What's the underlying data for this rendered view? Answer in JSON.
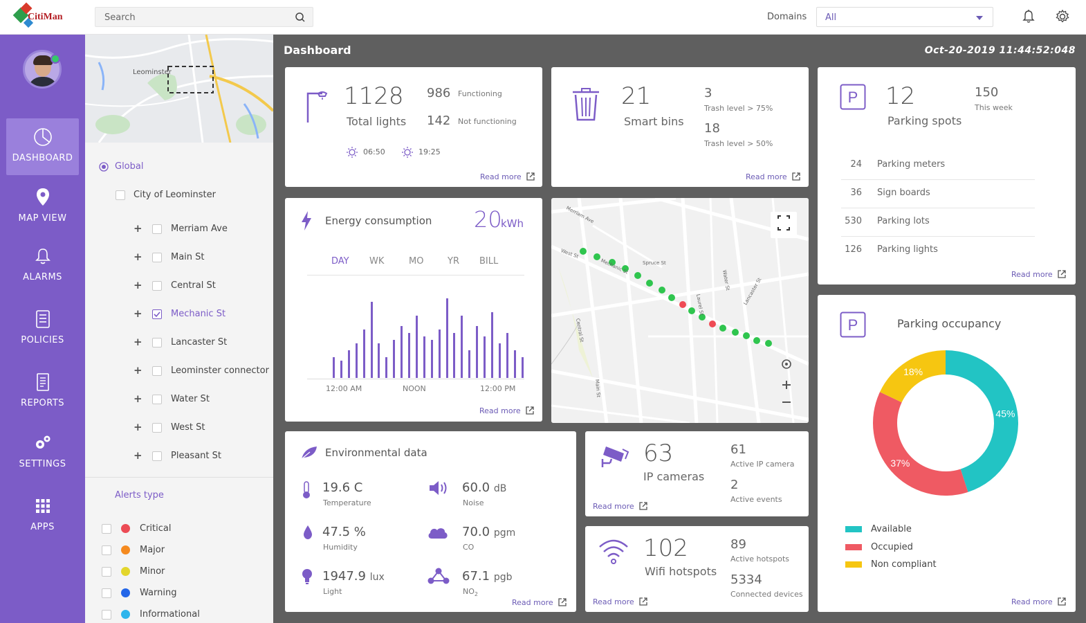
{
  "app": {
    "logo_text": "CitiMan"
  },
  "topbar": {
    "search_placeholder": "Search",
    "domains_label": "Domains",
    "domain_value": "All"
  },
  "nav": {
    "items": [
      {
        "id": "dashboard",
        "label": "DASHBOARD"
      },
      {
        "id": "map",
        "label": "MAP VIEW"
      },
      {
        "id": "alarms",
        "label": "ALARMS"
      },
      {
        "id": "policies",
        "label": "POLICIES"
      },
      {
        "id": "reports",
        "label": "REPORTS"
      },
      {
        "id": "settings",
        "label": "SETTINGS"
      },
      {
        "id": "apps",
        "label": "APPS"
      }
    ]
  },
  "left": {
    "map_label": "Leominster",
    "global_label": "Global",
    "city_label": "City of Leominster",
    "streets": [
      "Merriam Ave",
      "Main St",
      "Central St",
      "Mechanic St",
      "Lancaster St",
      "Leominster connector",
      "Water St",
      "West St",
      "Pleasant St"
    ],
    "checked_street": "Mechanic St",
    "alerts_title": "Alerts type",
    "alerts": [
      {
        "label": "Critical",
        "color": "#ec4b55"
      },
      {
        "label": "Major",
        "color": "#f58a1f"
      },
      {
        "label": "Minor",
        "color": "#e3d62c"
      },
      {
        "label": "Warning",
        "color": "#2366e8"
      },
      {
        "label": "Informational",
        "color": "#2eb5ec"
      }
    ]
  },
  "main": {
    "title": "Dashboard",
    "datetime": "Oct-20-2019 11:44:52:048",
    "read_more": "Read more",
    "lights": {
      "total": "1128",
      "total_label": "Total lights",
      "functioning": "986",
      "functioning_label": "Functioning",
      "not_functioning": "142",
      "not_functioning_label": "Not functioning",
      "sunrise": "06:50",
      "sunset": "19:25"
    },
    "bins": {
      "total": "21",
      "label": "Smart bins",
      "v1": "3",
      "l1": "Trash level > 75%",
      "v2": "18",
      "l2": "Trash level > 50%"
    },
    "parking": {
      "total": "12",
      "label": "Parking spots",
      "week": "150",
      "week_label": "This week",
      "rows": [
        {
          "n": "24",
          "l": "Parking meters"
        },
        {
          "n": "36",
          "l": "Sign boards"
        },
        {
          "n": "530",
          "l": "Parking lots"
        },
        {
          "n": "126",
          "l": "Parking lights"
        }
      ]
    },
    "energy": {
      "title": "Energy consumption",
      "value": "20",
      "unit": "kWh",
      "tabs": [
        "DAY",
        "WK",
        "MO",
        "YR",
        "BILL"
      ],
      "active_tab": "DAY",
      "x_labels": [
        "12:00 AM",
        "NOON",
        "12:00 PM"
      ]
    },
    "occupancy": {
      "title": "Parking occupancy",
      "legend": [
        "Available",
        "Occupied",
        "Non compliant"
      ]
    },
    "env": {
      "title": "Environmental data",
      "items": [
        {
          "value": "19.6 C",
          "unit": "",
          "label": "Temperature"
        },
        {
          "value": "60.0",
          "unit": "dB",
          "label": "Noise"
        },
        {
          "value": "47.5 %",
          "unit": "",
          "label": "Humidity"
        },
        {
          "value": "70.0",
          "unit": "pgm",
          "label": "CO"
        },
        {
          "value": "1947.9",
          "unit": "lux",
          "label": "Light"
        },
        {
          "value": "67.1",
          "unit": "pgb",
          "label": "NO2"
        }
      ]
    },
    "cameras": {
      "total": "63",
      "label": "IP cameras",
      "v1": "61",
      "l1": "Active IP camera",
      "v2": "2",
      "l2": "Active events"
    },
    "wifi": {
      "total": "102",
      "label": "Wifi hotspots",
      "v1": "89",
      "l1": "Active hotspots",
      "v2": "5334",
      "l2": "Connected devices"
    },
    "map_streets": [
      "Merriam Ave",
      "Mechanic St",
      "Central St",
      "Main St",
      "West St",
      "Spruce St",
      "Lancaster St",
      "Water St",
      "Laurel St"
    ]
  },
  "chart_data": [
    {
      "type": "bar",
      "title": "Energy consumption",
      "x_labels": [
        "12:00 AM",
        "NOON",
        "12:00 PM"
      ],
      "values": [
        3,
        2.5,
        4,
        5,
        7,
        11,
        5,
        3,
        5.5,
        7.5,
        6.5,
        9,
        6,
        5.5,
        7,
        11.5,
        6.5,
        9,
        4,
        7.5,
        6,
        9.5,
        5,
        6.5,
        4,
        3
      ]
    },
    {
      "type": "pie",
      "title": "Parking occupancy",
      "labels": [
        "Available",
        "Occupied",
        "Non compliant"
      ],
      "values": [
        45,
        37,
        18
      ],
      "colors": [
        "#22c4c4",
        "#ef5a63",
        "#f6c611"
      ]
    }
  ]
}
